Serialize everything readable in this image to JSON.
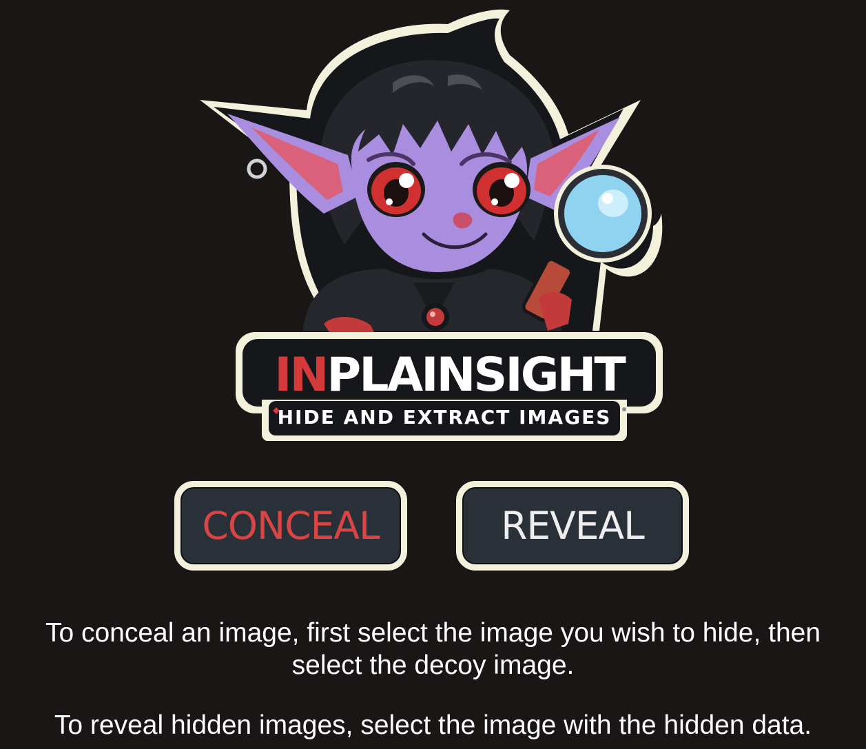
{
  "logo": {
    "title_red": "IN",
    "title_white": "PLAINSIGHT",
    "subtitle": "HIDE AND EXTRACT IMAGES",
    "colors": {
      "accent_red": "#d43a3a",
      "skin_purple": "#a98ee0",
      "hair": "#232428",
      "outline": "#f3f0dc",
      "lens": "#8fd3f0"
    }
  },
  "buttons": {
    "conceal_label": "CONCEAL",
    "reveal_label": "REVEAL"
  },
  "instructions": {
    "conceal_text": "To conceal an image, first select the image you wish to hide, then select the decoy image.",
    "reveal_text": "To reveal hidden images, select the image with the hidden data."
  },
  "colors": {
    "background": "#1b1616",
    "button_bg": "#2a3038",
    "button_border": "#f3f0dc",
    "conceal_text": "#d94545",
    "reveal_text": "#eeeeee"
  }
}
